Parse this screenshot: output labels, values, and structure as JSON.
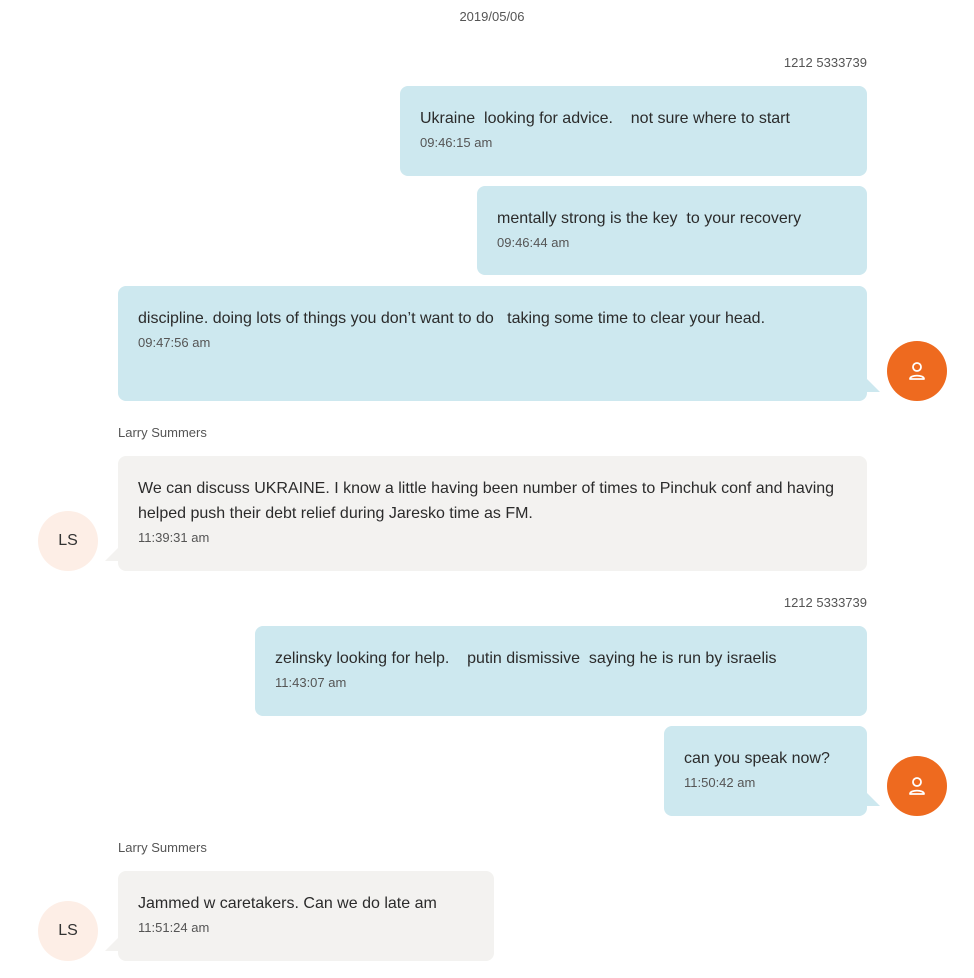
{
  "conversation": {
    "date": "2019/05/06",
    "blocks": [
      {
        "sender": "1212 5333739"
      },
      {
        "sender": "Larry Summers"
      },
      {
        "sender": "1212 5333739"
      },
      {
        "sender": "Larry Summers"
      }
    ],
    "messages": [
      {
        "text": "Ukraine  looking for advice.    not sure where to start",
        "time": "09:46:15 am"
      },
      {
        "text": "mentally strong is the key  to your recovery",
        "time": "09:46:44 am"
      },
      {
        "text": "discipline. doing lots of things you don’t want to do   taking some time to clear your head.",
        "time": "09:47:56 am"
      },
      {
        "text": "We can discuss UKRAINE. I know a little having been number of times to Pinchuk conf and having helped push their debt relief during Jaresko time as FM.",
        "time": "11:39:31 am"
      },
      {
        "text": "zelinsky looking for help.    putin dismissive  saying he is run by israelis",
        "time": "11:43:07 am"
      },
      {
        "text": "can you speak now?",
        "time": "11:50:42 am"
      },
      {
        "text": "Jammed w caretakers. Can we do late am",
        "time": "11:51:24 am"
      }
    ],
    "avatars": {
      "self_icon": "person-icon",
      "other_initials": "LS"
    },
    "colors": {
      "outgoing_bubble": "#cde8ef",
      "incoming_bubble": "#f3f2f0",
      "self_avatar": "#ee6a1f",
      "other_avatar": "#fdeee6"
    }
  }
}
